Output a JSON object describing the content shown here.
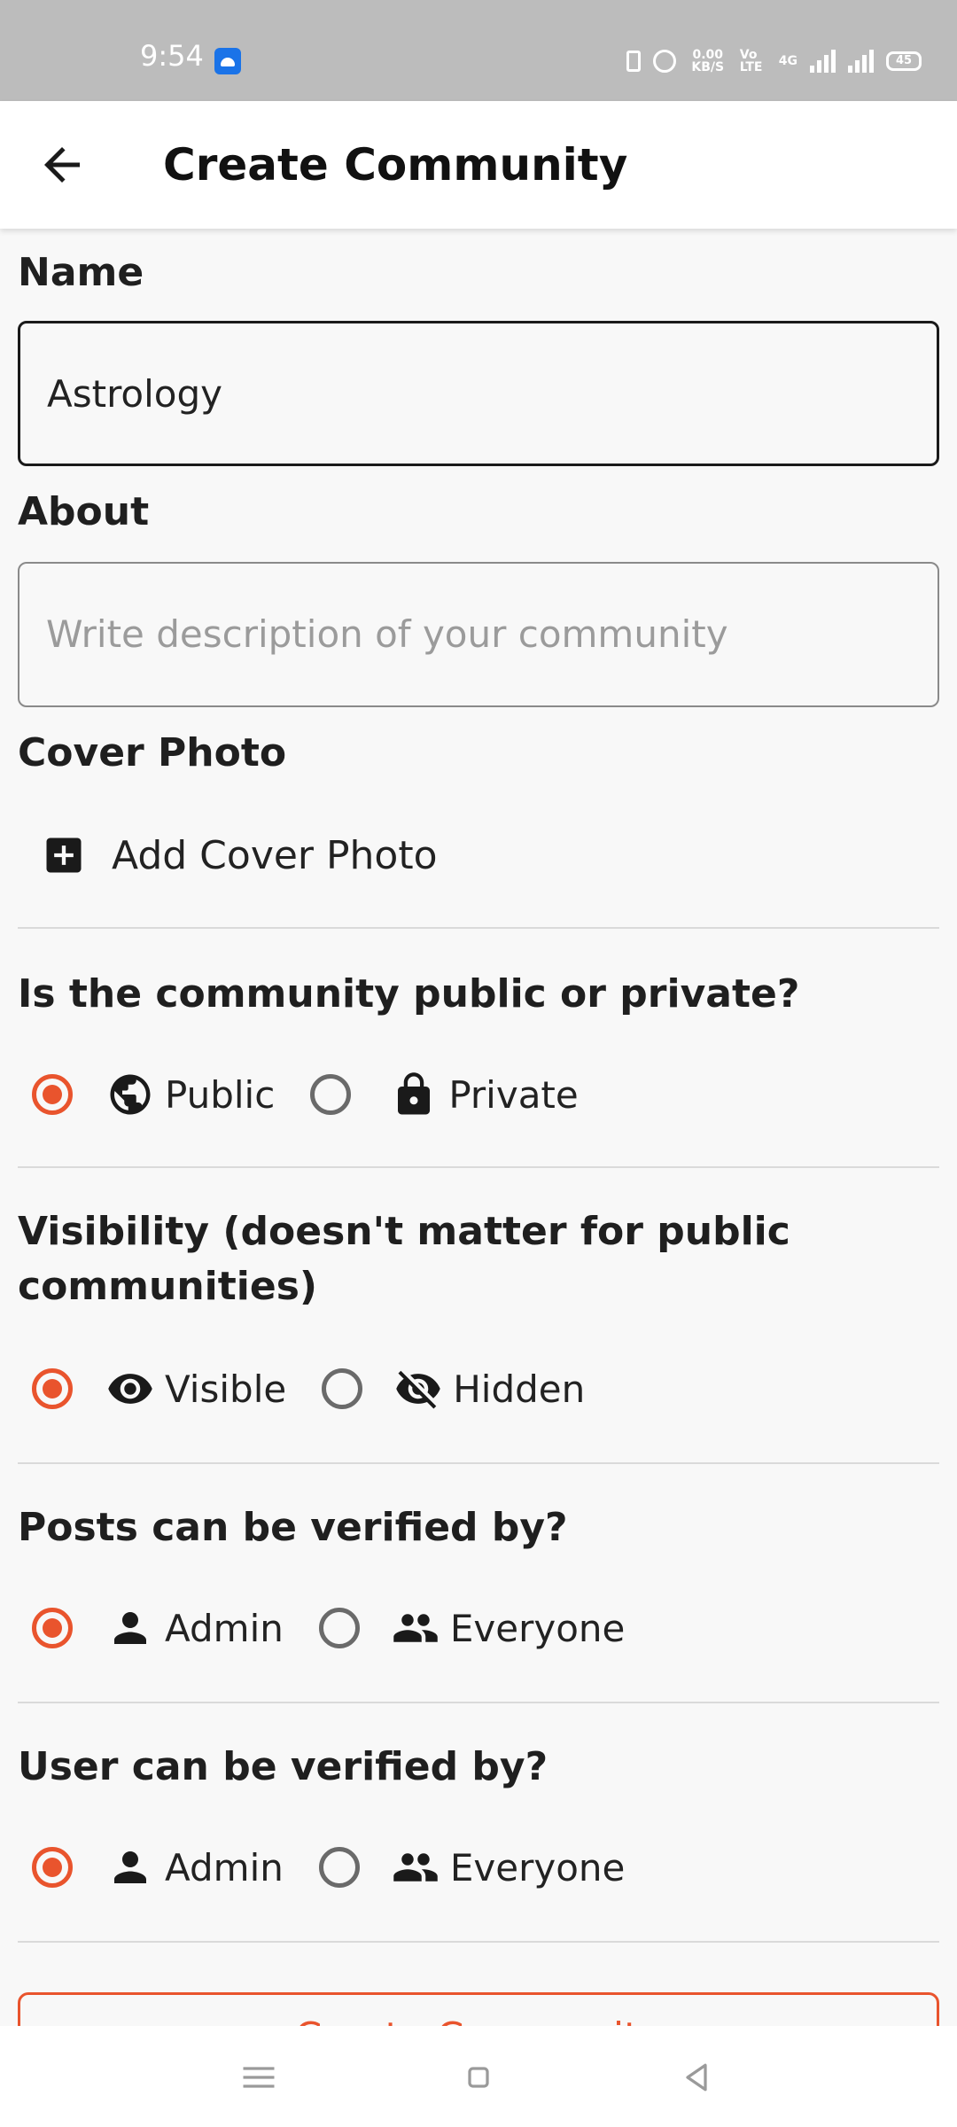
{
  "status_bar": {
    "time": "9:54",
    "network_speed": "0.00 KB/S",
    "network_type": "4G",
    "volte": "Vo LTE",
    "battery": "45"
  },
  "app_bar": {
    "title": "Create Community",
    "back_icon": "arrow-back-icon"
  },
  "form": {
    "name": {
      "label": "Name",
      "value": "Astrology"
    },
    "about": {
      "label": "About",
      "placeholder": "Write description of your community",
      "value": ""
    },
    "cover_photo": {
      "label": "Cover Photo",
      "button_label": "Add Cover Photo",
      "icon": "add-box-icon"
    },
    "privacy": {
      "question": "Is the community public or private?",
      "options": [
        {
          "label": "Public",
          "icon": "globe-icon",
          "selected": true
        },
        {
          "label": "Private",
          "icon": "lock-icon",
          "selected": false
        }
      ]
    },
    "visibility": {
      "question_line1": "Visibility (doesn't matter for public",
      "question_line2": "communities)",
      "options": [
        {
          "label": "Visible",
          "icon": "eye-icon",
          "selected": true
        },
        {
          "label": "Hidden",
          "icon": "eye-off-icon",
          "selected": false
        }
      ]
    },
    "posts_verified_by": {
      "question": "Posts can be verified by?",
      "options": [
        {
          "label": "Admin",
          "icon": "person-icon",
          "selected": true
        },
        {
          "label": "Everyone",
          "icon": "group-icon",
          "selected": false
        }
      ]
    },
    "user_verified_by": {
      "question": "User can be verified by?",
      "options": [
        {
          "label": "Admin",
          "icon": "person-icon",
          "selected": true
        },
        {
          "label": "Everyone",
          "icon": "group-icon",
          "selected": false
        }
      ]
    },
    "submit_label": "Create Community"
  },
  "colors": {
    "accent": "#e9542d",
    "status_bar": "#bcbcbc",
    "background": "#f8f8f8",
    "text": "#1f1f1f"
  },
  "nav_bar": {
    "items": [
      "menu-icon",
      "home-square-icon",
      "back-triangle-icon"
    ]
  }
}
